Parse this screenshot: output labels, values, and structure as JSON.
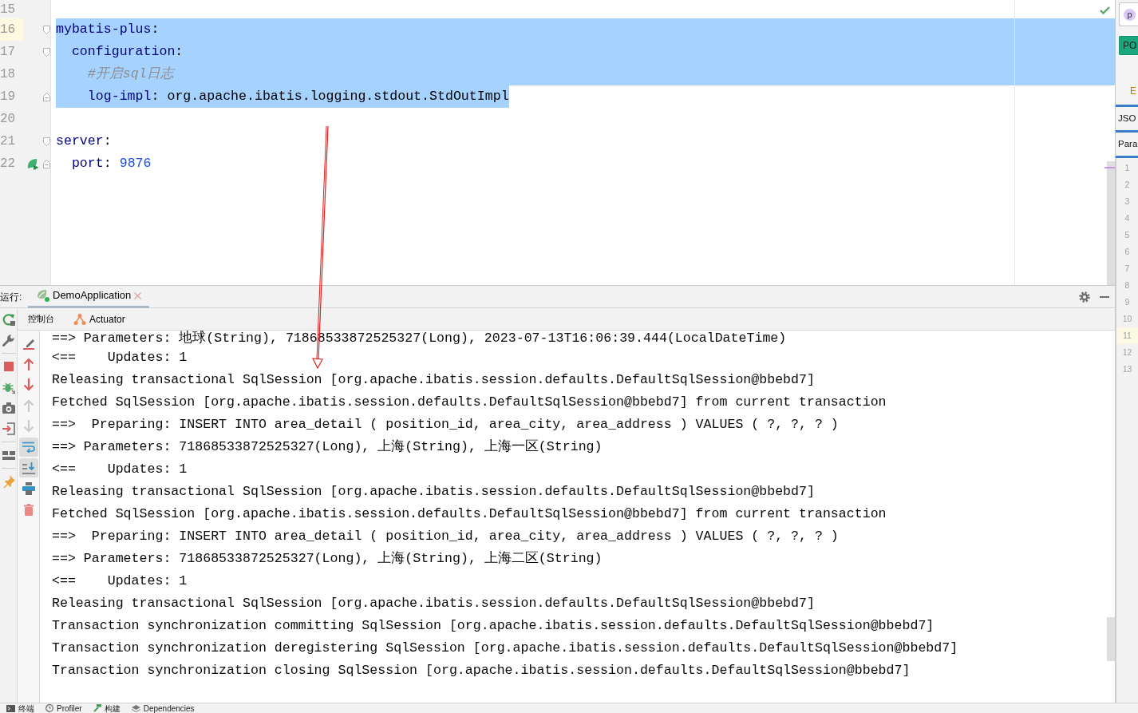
{
  "editor": {
    "gutter": [
      {
        "number": "15",
        "current": false,
        "run_marker": false,
        "kind": "plain"
      },
      {
        "number": "16",
        "current": true,
        "run_marker": false,
        "kind": "fold_start"
      },
      {
        "number": "17",
        "current": false,
        "run_marker": false,
        "kind": "fold_start"
      },
      {
        "number": "18",
        "current": false,
        "run_marker": false,
        "kind": "plain"
      },
      {
        "number": "19",
        "current": false,
        "run_marker": false,
        "kind": "fold_end"
      },
      {
        "number": "20",
        "current": false,
        "run_marker": false,
        "kind": "plain"
      },
      {
        "number": "21",
        "current": false,
        "run_marker": false,
        "kind": "fold_start"
      },
      {
        "number": "22",
        "current": false,
        "run_marker": true,
        "kind": "fold_end"
      }
    ],
    "code": [
      {
        "kind": "blank"
      },
      {
        "kind": "line",
        "selected": true,
        "tokens": [
          {
            "kind": "key",
            "text": "mybatis-plus"
          },
          {
            "kind": "punct",
            "text": ":"
          }
        ],
        "children": [
          {
            "kind": "line",
            "selected": true,
            "tokens": [
              {
                "kind": "key",
                "text": "configuration"
              },
              {
                "kind": "punct",
                "text": ":"
              }
            ],
            "children": [
              {
                "kind": "line",
                "selected": true,
                "tokens": [
                  {
                    "kind": "comment",
                    "text": "#开启sql日志"
                  }
                ]
              },
              {
                "kind": "line",
                "selected": true,
                "tokens": [
                  {
                    "kind": "key",
                    "text": "log-impl"
                  },
                  {
                    "kind": "punct",
                    "text": ":"
                  },
                  {
                    "kind": "value",
                    "text": "org.apache.ibatis.logging.stdout.StdOutImpl"
                  }
                ]
              }
            ]
          }
        ]
      },
      {
        "kind": "blank"
      },
      {
        "kind": "line",
        "selected": false,
        "tokens": [
          {
            "kind": "key",
            "text": "server"
          },
          {
            "kind": "punct",
            "text": ":"
          }
        ],
        "children": [
          {
            "kind": "line",
            "selected": false,
            "tokens": [
              {
                "kind": "key",
                "text": "port"
              },
              {
                "kind": "punct",
                "text": ":"
              },
              {
                "kind": "number",
                "text": "9876"
              }
            ]
          }
        ]
      }
    ]
  },
  "run_panel": {
    "label": "运行:",
    "tabs": [
      {
        "label": "DemoApplication",
        "selected": true
      }
    ],
    "subtabs": [
      {
        "label": "控制台",
        "kind": "console"
      },
      {
        "label": "Actuator",
        "kind": "actuator"
      }
    ],
    "side_toolbar": [
      {
        "kind": "rerun"
      },
      {
        "kind": "wrench"
      },
      {
        "kind": "separator"
      },
      {
        "kind": "stop"
      },
      {
        "kind": "debug"
      },
      {
        "kind": "camera"
      },
      {
        "kind": "exit"
      },
      {
        "kind": "separator"
      },
      {
        "kind": "layout"
      },
      {
        "kind": "separator"
      },
      {
        "kind": "pin"
      }
    ],
    "console_toolbar": [
      {
        "kind": "clear",
        "disabled": false,
        "on": false
      },
      {
        "kind": "up",
        "disabled": false,
        "on": false
      },
      {
        "kind": "down",
        "disabled": false,
        "on": false
      },
      {
        "kind": "up",
        "disabled": true,
        "on": false
      },
      {
        "kind": "down",
        "disabled": true,
        "on": false
      },
      {
        "kind": "wrap",
        "disabled": false,
        "on": true
      },
      {
        "kind": "scroll-end",
        "disabled": false,
        "on": true
      },
      {
        "kind": "print",
        "disabled": false,
        "on": false
      },
      {
        "kind": "delete",
        "disabled": false,
        "on": false
      }
    ],
    "console": [
      "==> Parameters: 地球(String), 71868533872525327(Long), 2023-07-13T16:06:39.444(LocalDateTime)",
      "<==    Updates: 1",
      "Releasing transactional SqlSession [org.apache.ibatis.session.defaults.DefaultSqlSession@bbebd7]",
      "Fetched SqlSession [org.apache.ibatis.session.defaults.DefaultSqlSession@bbebd7] from current transaction",
      "==>  Preparing: INSERT INTO area_detail ( position_id, area_city, area_address ) VALUES ( ?, ?, ? )",
      "==> Parameters: 71868533872525327(Long), 上海(String), 上海一区(String)",
      "<==    Updates: 1",
      "Releasing transactional SqlSession [org.apache.ibatis.session.defaults.DefaultSqlSession@bbebd7]",
      "Fetched SqlSession [org.apache.ibatis.session.defaults.DefaultSqlSession@bbebd7] from current transaction",
      "==>  Preparing: INSERT INTO area_detail ( position_id, area_city, area_address ) VALUES ( ?, ?, ? )",
      "==> Parameters: 71868533872525327(Long), 上海(String), 上海二区(String)",
      "<==    Updates: 1",
      "Releasing transactional SqlSession [org.apache.ibatis.session.defaults.DefaultSqlSession@bbebd7]",
      "Transaction synchronization committing SqlSession [org.apache.ibatis.session.defaults.DefaultSqlSession@bbebd7]",
      "Transaction synchronization deregistering SqlSession [org.apache.ibatis.session.defaults.DefaultSqlSession@bbebd7]",
      "Transaction synchronization closing SqlSession [org.apache.ibatis.session.defaults.DefaultSqlSession@bbebd7]"
    ]
  },
  "side_panel": {
    "avatar": "p",
    "method": "PO",
    "tab_label": "E",
    "sections": [
      "JSO",
      "Para"
    ],
    "line_numbers": [
      {
        "number": "1",
        "current": false
      },
      {
        "number": "2",
        "current": false
      },
      {
        "number": "3",
        "current": false
      },
      {
        "number": "4",
        "current": false
      },
      {
        "number": "5",
        "current": false
      },
      {
        "number": "6",
        "current": false
      },
      {
        "number": "7",
        "current": false
      },
      {
        "number": "8",
        "current": false
      },
      {
        "number": "9",
        "current": false
      },
      {
        "number": "10",
        "current": false
      },
      {
        "number": "11",
        "current": true
      },
      {
        "number": "12",
        "current": false
      },
      {
        "number": "13",
        "current": false
      }
    ]
  },
  "tool_windows": [
    {
      "kind": "terminal",
      "label": "终端"
    },
    {
      "kind": "profiler",
      "label": "Profiler"
    },
    {
      "kind": "build",
      "label": "构建"
    },
    {
      "kind": "dependencies",
      "label": "Dependencies"
    }
  ]
}
